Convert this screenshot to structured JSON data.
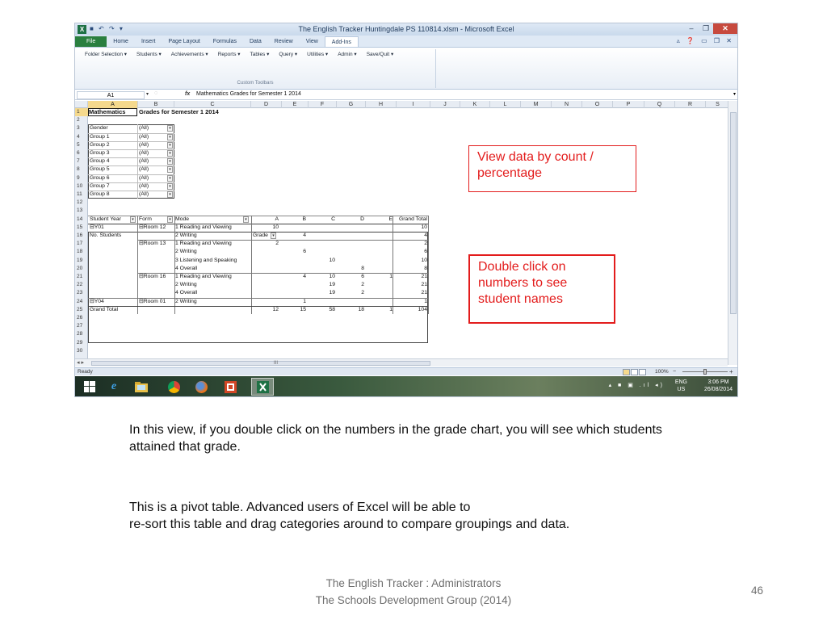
{
  "excel": {
    "window_title": "The English Tracker Huntingdale PS 110814.xlsm - Microsoft Excel",
    "app_icon": "X",
    "qat": "■ ↶ ↷ ▾",
    "window_buttons": [
      "–",
      "❐",
      "✕"
    ],
    "tabs": [
      "File",
      "Home",
      "Insert",
      "Page Layout",
      "Formulas",
      "Data",
      "Review",
      "View",
      "Add-Ins"
    ],
    "active_tab": "Add-Ins",
    "ribbon_right_icons": "▵ ❓ ▭ ❐ ✕",
    "ribbon_menus": [
      "Folder Selection ▾",
      "Students ▾",
      "Achievements ▾",
      "Reports ▾",
      "Tables ▾",
      "Query ▾",
      "Utilities ▾",
      "Admin ▾",
      "Save/Quit ▾"
    ],
    "ribbon_group_label": "Custom Toolbars",
    "name_box": "A1",
    "fx_label": "fx",
    "formula": "Mathematics Grades for Semester 1 2014",
    "columns": [
      "A",
      "B",
      "C",
      "D",
      "E",
      "F",
      "G",
      "H",
      "I",
      "J",
      "K",
      "L",
      "M",
      "N",
      "O",
      "P",
      "Q",
      "R",
      "S"
    ],
    "rows": [
      "1",
      "2",
      "3",
      "4",
      "5",
      "6",
      "7",
      "8",
      "9",
      "10",
      "11",
      "12",
      "13",
      "14",
      "15",
      "16",
      "17",
      "18",
      "19",
      "20",
      "21",
      "22",
      "23",
      "24",
      "25",
      "26",
      "27",
      "28",
      "29",
      "30"
    ],
    "sheet": {
      "title_a": "Mathematics",
      "title_rest": "Grades for Semester 1 2014",
      "filters": [
        {
          "label": "Gender",
          "value": "(All)"
        },
        {
          "label": "Group 1",
          "value": "(All)"
        },
        {
          "label": "Group 2",
          "value": "(All)"
        },
        {
          "label": "Group 3",
          "value": "(All)"
        },
        {
          "label": "Group 4",
          "value": "(All)"
        },
        {
          "label": "Group 5",
          "value": "(All)"
        },
        {
          "label": "Group 6",
          "value": "(All)"
        },
        {
          "label": "Group 7",
          "value": "(All)"
        },
        {
          "label": "Group 8",
          "value": "(All)"
        }
      ],
      "pivot_measure": "No. Students",
      "pivot_col_field": "Grade",
      "pivot_headers": [
        "Student Year",
        "Form",
        "Mode",
        "A",
        "B",
        "C",
        "D",
        "E",
        "Grand Total"
      ],
      "pivot_rows": [
        {
          "year": "⊟Y01",
          "form": "⊟Room 12",
          "mode": "1 Reading and Viewing",
          "A": "10",
          "B": "",
          "C": "",
          "D": "",
          "E": "",
          "total": "10"
        },
        {
          "year": "",
          "form": "",
          "mode": "2 Writing",
          "A": "",
          "B": "4",
          "C": "",
          "D": "",
          "E": "",
          "total": "4"
        },
        {
          "year": "",
          "form": "⊟Room 13",
          "mode": "1 Reading and Viewing",
          "A": "2",
          "B": "",
          "C": "",
          "D": "",
          "E": "",
          "total": "2"
        },
        {
          "year": "",
          "form": "",
          "mode": "2 Writing",
          "A": "",
          "B": "6",
          "C": "",
          "D": "",
          "E": "",
          "total": "6"
        },
        {
          "year": "",
          "form": "",
          "mode": "3 Listening and Speaking",
          "A": "",
          "B": "",
          "C": "10",
          "D": "",
          "E": "",
          "total": "10"
        },
        {
          "year": "",
          "form": "",
          "mode": "4 Overall",
          "A": "",
          "B": "",
          "C": "",
          "D": "8",
          "E": "",
          "total": "8"
        },
        {
          "year": "",
          "form": "⊟Room 16",
          "mode": "1 Reading and Viewing",
          "A": "",
          "B": "4",
          "C": "10",
          "D": "6",
          "E": "1",
          "total": "21"
        },
        {
          "year": "",
          "form": "",
          "mode": "2 Writing",
          "A": "",
          "B": "",
          "C": "19",
          "D": "2",
          "E": "",
          "total": "21"
        },
        {
          "year": "",
          "form": "",
          "mode": "4 Overall",
          "A": "",
          "B": "",
          "C": "19",
          "D": "2",
          "E": "",
          "total": "21"
        },
        {
          "year": "⊟Y04",
          "form": "⊟Room  01",
          "mode": "2 Writing",
          "A": "",
          "B": "1",
          "C": "",
          "D": "",
          "E": "",
          "total": "1"
        }
      ],
      "grand_total_label": "Grand Total",
      "grand_totals": {
        "A": "12",
        "B": "15",
        "C": "58",
        "D": "18",
        "E": "1",
        "total": "104"
      }
    },
    "status": "Ready",
    "zoom": "100%",
    "zoom_minus": "−",
    "zoom_plus": "+",
    "sheet_nav": "◂ ▸",
    "hscroll_mark": "III",
    "tray": {
      "lang_top": "ENG",
      "lang_bottom": "US",
      "time": "3:06 PM",
      "date": "26/08/2014",
      "icons": "▴ ■ ▣ .ıl ◂)"
    }
  },
  "callouts": {
    "view_data": "View data by count / percentage",
    "double_click": "Double click on numbers to see student names"
  },
  "body": {
    "para1": "In this view, if you double click on the numbers in the grade chart, you will see which students attained that grade.",
    "para2_line1": "This is a pivot table.  Advanced users of Excel will be able to",
    "para2_line2": "re-sort this table and drag categories around to compare groupings and data."
  },
  "footer": {
    "line1": "The English Tracker :   Administrators",
    "line2": "The Schools Development Group  (2014)"
  },
  "page_number": "46"
}
